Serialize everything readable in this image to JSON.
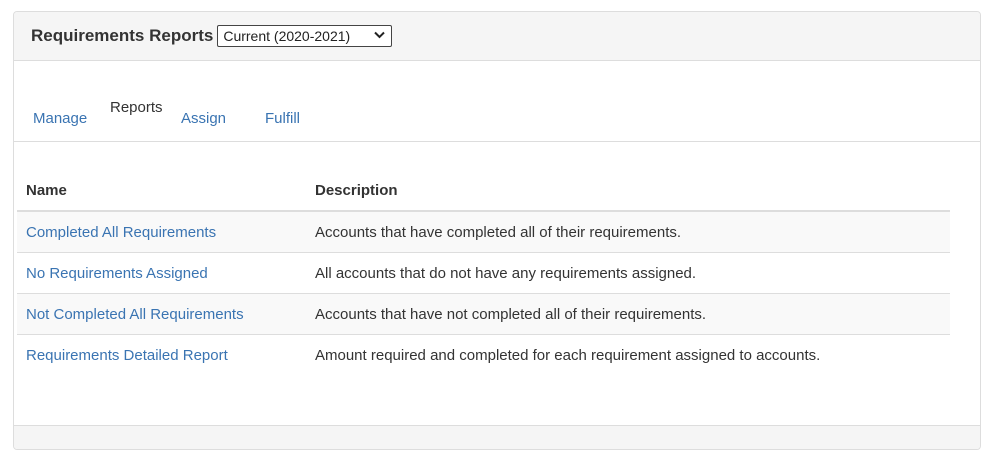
{
  "header": {
    "title": "Requirements Reports",
    "year_select": {
      "selected": "Current (2020-2021)",
      "icon": "chevron-down-icon"
    }
  },
  "tabs": [
    {
      "label": "Manage",
      "active": false
    },
    {
      "label": "Reports",
      "active": true
    },
    {
      "label": "Assign",
      "active": false
    },
    {
      "label": "Fulfill",
      "active": false
    }
  ],
  "table": {
    "columns": [
      "Name",
      "Description"
    ],
    "rows": [
      {
        "name": "Completed All Requirements",
        "description": "Accounts that have completed all of their requirements."
      },
      {
        "name": "No Requirements Assigned",
        "description": "All accounts that do not have any requirements assigned."
      },
      {
        "name": "Not Completed All Requirements",
        "description": "Accounts that have not completed all of their requirements."
      },
      {
        "name": "Requirements Detailed Report",
        "description": "Amount required and completed for each requirement assigned to accounts."
      }
    ]
  },
  "colors": {
    "link": "#3a74b2",
    "header_bg": "#f5f5f5",
    "border": "#dddddd",
    "stripe": "#f9f9f9"
  }
}
